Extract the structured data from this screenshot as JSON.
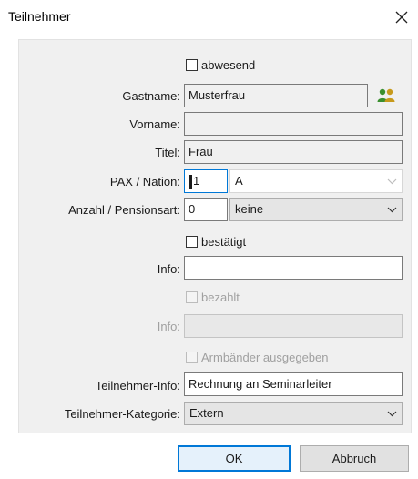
{
  "window": {
    "title": "Teilnehmer",
    "close_glyph": "×"
  },
  "form": {
    "abwesend": {
      "label": "abwesend",
      "checked": false
    },
    "gastname": {
      "label": "Gastname:",
      "value": "Musterfrau",
      "icon": "people-icon"
    },
    "vorname": {
      "label": "Vorname:",
      "value": ""
    },
    "titel": {
      "label": "Titel:",
      "value": "Frau"
    },
    "pax_nation": {
      "label": "PAX / Nation:",
      "pax_value": "1",
      "nation_value": "A"
    },
    "anzahl_pension": {
      "label": "Anzahl / Pensionsart:",
      "anzahl_value": "0",
      "pensionsart_value": "keine"
    },
    "bestaetigt": {
      "label": "bestätigt",
      "checked": false
    },
    "info1": {
      "label": "Info:",
      "value": ""
    },
    "bezahlt": {
      "label": "bezahlt",
      "checked": false,
      "disabled": true
    },
    "info2": {
      "label": "Info:",
      "value": "",
      "disabled": true
    },
    "armbaender": {
      "label": "Armbänder ausgegeben",
      "checked": false,
      "disabled": true
    },
    "teilnehmer_info": {
      "label": "Teilnehmer-Info:",
      "value": "Rechnung an Seminarleiter"
    },
    "teilnehmer_kategorie": {
      "label": "Teilnehmer-Kategorie:",
      "value": "Extern"
    }
  },
  "buttons": {
    "ok": {
      "mnemonic": "O",
      "rest": "K"
    },
    "cancel": {
      "pre": "Ab",
      "mnemonic": "b",
      "post": "ruch"
    }
  },
  "colors": {
    "accent": "#0078d7",
    "panel": "#f0f0f0",
    "people_icon_a": "#3a8f2e",
    "people_icon_b": "#c79a1c"
  }
}
